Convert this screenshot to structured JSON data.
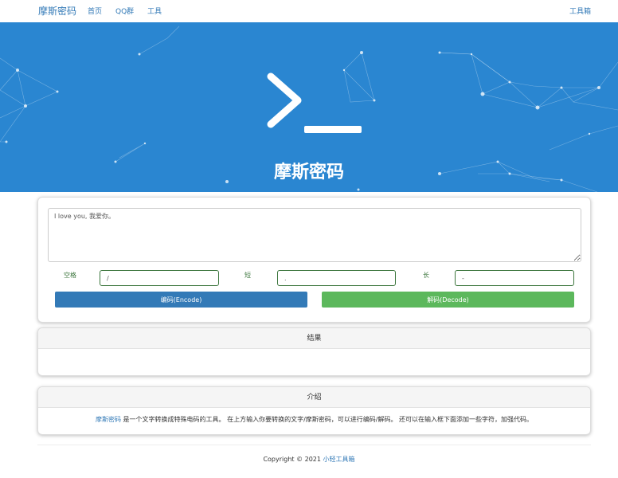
{
  "navbar": {
    "brand": "摩斯密码",
    "items": [
      {
        "label": "首页"
      },
      {
        "label": "QQ群"
      },
      {
        "label": "工具"
      }
    ],
    "right_label": "工具箱"
  },
  "hero": {
    "title": "摩斯密码",
    "icon": "terminal-icon",
    "background_color": "#2a86d1"
  },
  "input": {
    "text_value": "I love you, 我爱你。",
    "space_label": "空格",
    "space_value": "/",
    "short_label": "短",
    "short_value": ".",
    "long_label": "长",
    "long_value": "-",
    "encode_label": "编码(Encode)",
    "decode_label": "解码(Decode)",
    "encode_color": "#337ab7",
    "decode_color": "#5cb85c"
  },
  "result": {
    "header": "结果",
    "content": ""
  },
  "intro": {
    "header": "介绍",
    "link_text": "摩斯密码",
    "description": " 是一个文字转换成特殊电码的工具。 在上方输入你要转换的文字/摩斯密码，可以进行编码/解码。 还可以在输入框下面添加一些字符，加强代码。"
  },
  "footer": {
    "copyright": "Copyright © 2021 ",
    "link_text": "小轻工具箱"
  }
}
